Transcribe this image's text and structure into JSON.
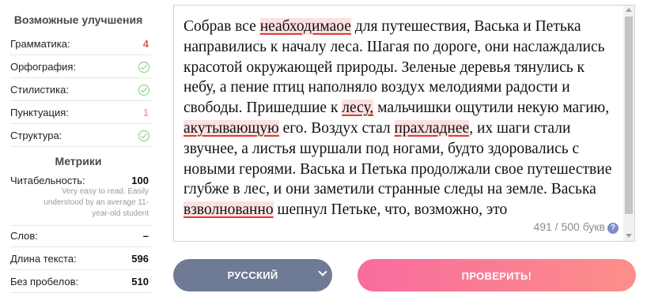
{
  "sidebar": {
    "improvements_title": "Возможные улучшения",
    "improvements": [
      {
        "label": "Грамматика:",
        "value": "4"
      },
      {
        "label": "Орфография:",
        "status_icon": "check-circle-icon"
      },
      {
        "label": "Стилистика:",
        "status_icon": "check-circle-icon"
      },
      {
        "label": "Пунктуация:",
        "value": "1"
      },
      {
        "label": "Структура:",
        "status_icon": "check-circle-icon"
      }
    ],
    "metrics_title": "Метрики",
    "readability": {
      "label": "Читабельность:",
      "value": "100",
      "description": "Very easy to read. Easily understood by an average 11-year-old student"
    },
    "metrics": [
      {
        "label": "Слов:",
        "value": "–"
      },
      {
        "label": "Длина текста:",
        "value": "596"
      },
      {
        "label": "Без пробелов:",
        "value": "510"
      }
    ]
  },
  "editor": {
    "segments": [
      {
        "text": "Собрав все "
      },
      {
        "text": "неабходимаое",
        "error": true
      },
      {
        "text": " для путешествия, Васька и Петька направились к началу леса. Шагая по дороге, они наслаждались красотой окружающей природы. Зеленые деревья тянулись к небу, а пение птиц наполняло воздух мелодиями радости и свободы. Пришедшие к "
      },
      {
        "text": "лесу,",
        "error": true
      },
      {
        "text": " мальчишки ощутили некую магию, "
      },
      {
        "text": "акутывающую",
        "error": true
      },
      {
        "text": " его. Воздух стал "
      },
      {
        "text": "прахладнее",
        "error": true
      },
      {
        "text": ", их шаги стали звучнее, а листья шуршали под ногами, будто здоровались с новыми героями. Васька и Петька продолжали свое путешествие глубже в лес, и они заметили странные следы на земле.  Васька "
      },
      {
        "text": "взволнованно",
        "error": true
      },
      {
        "text": " шепнул Петьке, что, возможно, это"
      }
    ],
    "counter": "491 / 500 букв",
    "help_icon": "?"
  },
  "buttons": {
    "language": "РУССКИЙ",
    "check": "ПРОВЕРИТЬ!"
  },
  "colors": {
    "error_highlight": "#fde0e0",
    "error_underline": "#e53935",
    "ok_green": "#7ccf7c",
    "lang_button": "#6f7a95",
    "check_gradient_start": "#f86b9e",
    "check_gradient_end": "#fc8f89"
  }
}
